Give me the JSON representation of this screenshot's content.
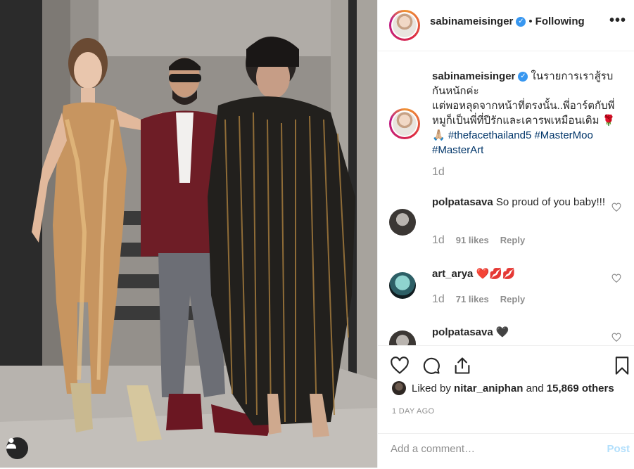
{
  "post": {
    "account": "sabinameisinger",
    "verified_mark": "✓",
    "header_separator": "•",
    "follow_status": "Following",
    "more_label": "•••"
  },
  "caption": {
    "username": "sabinameisinger",
    "lines": [
      " ในรายการเราสู้รบ",
      "กันหนักค่ะ",
      "แต่พอหลุดจากหน้าที่ตรงนั้น..พี่อาร์ตกับพี่",
      "หมูก็เป็นพี่ที่ปีรักและเคารพเหมือนเดิม 🌹",
      "🙏🏼 "
    ],
    "hashtags": [
      "#thefacethailand5",
      "#MasterMoo",
      "#MasterArt"
    ],
    "time": "1d"
  },
  "comments": [
    {
      "username": "polpatasava",
      "text": "So proud of you baby!!!",
      "time": "1d",
      "likes": "91 likes",
      "reply": "Reply"
    },
    {
      "username": "art_arya",
      "text": "❤️💋💋",
      "time": "1d",
      "likes": "71 likes",
      "reply": "Reply"
    },
    {
      "username": "polpatasava",
      "text": "🖤",
      "time": "",
      "likes": "",
      "reply": ""
    }
  ],
  "icons": [
    "heart-icon",
    "comment-icon",
    "share-icon",
    "bookmark-icon",
    "user-tag-icon",
    "more-options-icon"
  ],
  "likes": {
    "prefix": "Liked by ",
    "user": "nitar_aniphan",
    "middle": " and ",
    "others": "15,869 others"
  },
  "timestamp": "1 DAY AGO",
  "add_comment": {
    "placeholder": "Add a comment…",
    "post_label": "Post"
  },
  "colors": {
    "link": "#003569",
    "verified": "#3897f0",
    "post_disabled": "#b2dffc",
    "meta_gray": "#8e8e8e"
  }
}
